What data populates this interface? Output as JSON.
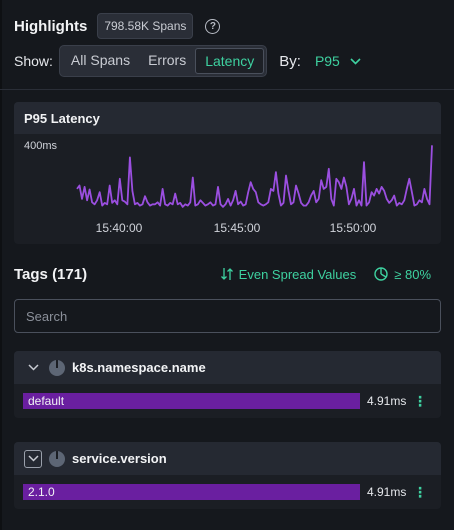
{
  "header": {
    "title": "Highlights",
    "span_count": "798.58K Spans",
    "help": "?"
  },
  "show": {
    "label": "Show:",
    "options": [
      "All Spans",
      "Errors",
      "Latency"
    ],
    "selected": "Latency"
  },
  "by": {
    "label": "By:",
    "value": "P95"
  },
  "accent_color": "#3ed1a0",
  "bar_color": "#6a1fa0",
  "line_color": "#9b4fe0",
  "chart_data": {
    "type": "line",
    "title": "P95 Latency",
    "y_tick_label": "400ms",
    "x_tick_labels": [
      "15:40:00",
      "15:45:00",
      "15:50:00"
    ],
    "values": [
      45,
      50,
      30,
      48,
      28,
      44,
      25,
      22,
      28,
      40,
      20,
      24,
      22,
      50,
      24,
      28,
      22,
      60,
      28,
      26,
      22,
      92,
      42,
      22,
      24,
      20,
      22,
      34,
      25,
      20,
      22,
      22,
      25,
      20,
      45,
      22,
      20,
      24,
      22,
      38,
      22,
      24,
      18,
      22,
      20,
      25,
      62,
      20,
      22,
      28,
      24,
      20,
      22,
      25,
      20,
      22,
      48,
      22,
      18,
      22,
      30,
      20,
      28,
      42,
      22,
      26,
      20,
      22,
      40,
      55,
      45,
      40,
      25,
      22,
      20,
      22,
      25,
      45,
      42,
      70,
      38,
      20,
      24,
      65,
      42,
      22,
      25,
      50,
      38,
      24,
      20,
      20,
      25,
      35,
      42,
      25,
      30,
      58,
      45,
      48,
      75,
      30,
      20,
      60,
      55,
      45,
      62,
      48,
      22,
      30,
      45,
      20,
      28,
      20,
      85,
      20,
      25,
      40,
      35,
      45,
      38,
      48,
      42,
      30,
      24,
      28,
      35,
      20,
      24,
      22,
      28,
      45,
      60,
      40,
      20,
      22,
      28,
      25,
      45,
      30,
      22,
      110
    ],
    "y_ref_value": 400,
    "y_ref_position": 0.85
  },
  "tags": {
    "title": "Tags (171)",
    "spread_label": "Even Spread Values",
    "pct_label": "≥ 80%",
    "search_placeholder": "Search",
    "items": [
      {
        "name": "k8s.namespace.name",
        "bar_label": "default",
        "value": "4.91ms"
      },
      {
        "name": "service.version",
        "bar_label": "2.1.0",
        "value": "4.91ms"
      }
    ]
  }
}
